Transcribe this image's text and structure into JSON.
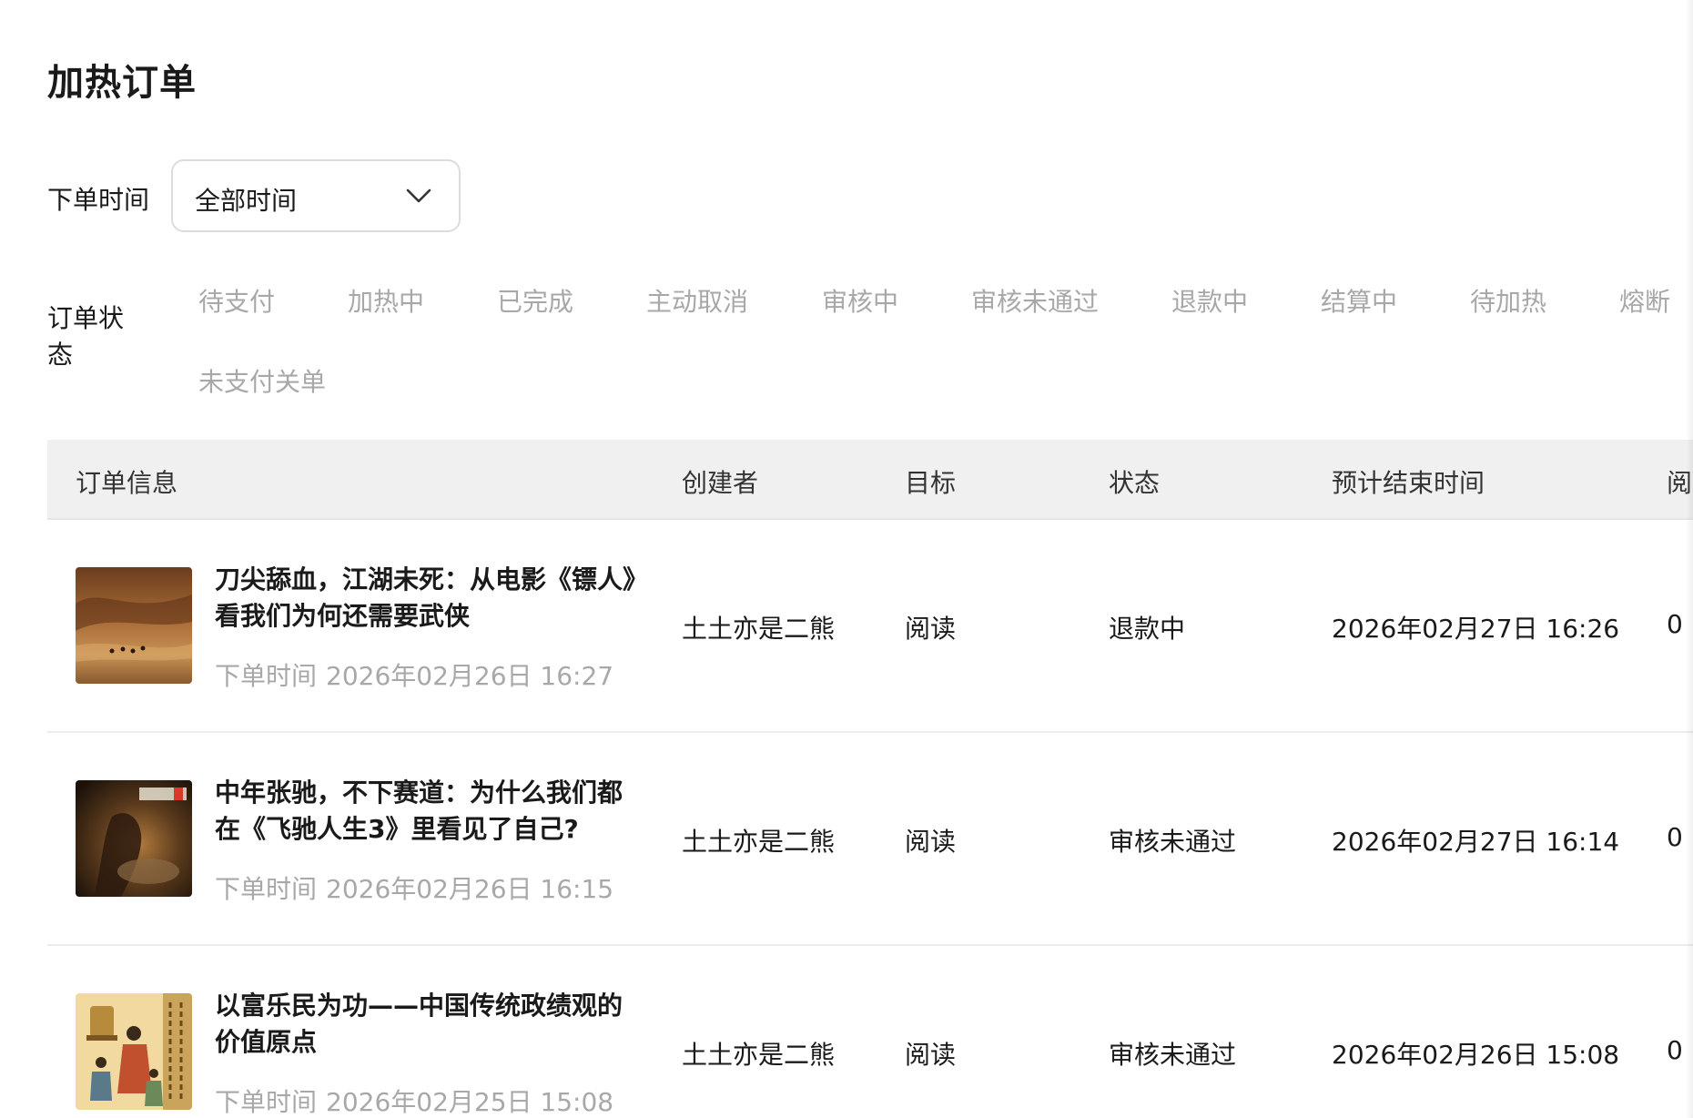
{
  "page": {
    "title": "加热订单"
  },
  "filters": {
    "time_label": "下单时间",
    "time_select": {
      "value": "全部时间"
    },
    "status_label": "订单状态",
    "status_tabs": [
      "待支付",
      "加热中",
      "已完成",
      "主动取消",
      "审核中",
      "审核未通过",
      "退款中",
      "结算中",
      "待加热",
      "熔断",
      "未支付关单"
    ]
  },
  "table": {
    "columns": [
      "订单信息",
      "创建者",
      "目标",
      "状态",
      "预计结束时间",
      "阅"
    ],
    "rows": [
      {
        "title": "刀尖舔血，江湖未死：从电影《镖人》看我们为何还需要武侠",
        "order_time_label": "下单时间",
        "order_time": "2026年02月26日 16:27",
        "creator": "土土亦是二熊",
        "target": "阅读",
        "status": "退款中",
        "end_time": "2026年02月27日 16:26",
        "reads": "0"
      },
      {
        "title": "中年张驰，不下赛道：为什么我们都在《飞驰人生3》里看见了自己?",
        "order_time_label": "下单时间",
        "order_time": "2026年02月26日 16:15",
        "creator": "土土亦是二熊",
        "target": "阅读",
        "status": "审核未通过",
        "end_time": "2026年02月27日 16:14",
        "reads": "0"
      },
      {
        "title": "以富乐民为功——中国传统政绩观的价值原点",
        "order_time_label": "下单时间",
        "order_time": "2026年02月25日 15:08",
        "creator": "土土亦是二熊",
        "target": "阅读",
        "status": "审核未通过",
        "end_time": "2026年02月26日 15:08",
        "reads": "0"
      }
    ]
  }
}
